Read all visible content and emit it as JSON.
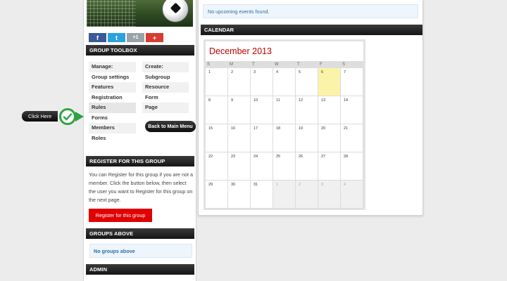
{
  "social": {
    "fb": "f",
    "tw": "t",
    "gp": "+1",
    "add": "+"
  },
  "toolbox": {
    "title": "GROUP TOOLBOX",
    "manage_header": "Manage:",
    "manage_items": [
      "Group settings",
      "Features",
      "Registration",
      "Rules",
      "Forms",
      "Members",
      "Roles"
    ],
    "create_header": "Create:",
    "create_items": [
      "Subgroup",
      "Resource",
      "Form",
      "Page"
    ],
    "back_button": "Back to Main Menu"
  },
  "callout": {
    "label": "Click Here"
  },
  "register": {
    "title": "REGISTER FOR THIS GROUP",
    "text": "You can Register for this group if you are not a member. Click the button below, then select the user you want to Register for this group on the next page.",
    "button": "Register for this group"
  },
  "groups_above": {
    "title": "GROUPS ABOVE",
    "empty": "No groups above"
  },
  "admin": {
    "title": "ADMIN"
  },
  "events": {
    "empty": "No upcoming events found."
  },
  "calendar": {
    "section_title": "CALENDAR",
    "month_title": "December 2013",
    "weekdays": [
      "S",
      "M",
      "T",
      "W",
      "T",
      "F",
      "S"
    ],
    "weeks": [
      [
        "1",
        "2",
        "3",
        "4",
        "5",
        "6",
        "7"
      ],
      [
        "8",
        "9",
        "10",
        "11",
        "12",
        "13",
        "14"
      ],
      [
        "15",
        "16",
        "17",
        "18",
        "19",
        "20",
        "21"
      ],
      [
        "22",
        "23",
        "24",
        "25",
        "26",
        "27",
        "28"
      ],
      [
        "29",
        "30",
        "31",
        "1",
        "2",
        "3",
        "4"
      ]
    ],
    "today": "6",
    "colors": {
      "title": "#c20000",
      "today": "#fbf4a8"
    }
  }
}
